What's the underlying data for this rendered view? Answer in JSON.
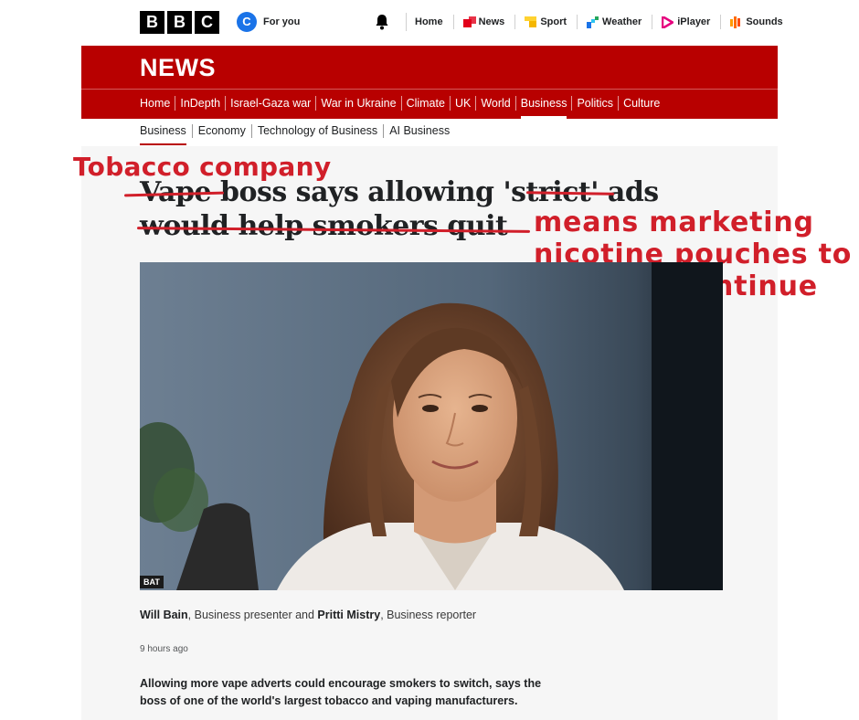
{
  "logo": {
    "letters": [
      "B",
      "B",
      "C"
    ]
  },
  "account": {
    "avatar_letter": "C",
    "label": "For you"
  },
  "topnav": [
    {
      "label": "Home",
      "icon": "none"
    },
    {
      "label": "News",
      "icon": "news-icon"
    },
    {
      "label": "Sport",
      "icon": "sport-icon"
    },
    {
      "label": "Weather",
      "icon": "weather-icon"
    },
    {
      "label": "iPlayer",
      "icon": "iplayer-icon"
    },
    {
      "label": "Sounds",
      "icon": "sounds-icon"
    }
  ],
  "news": {
    "title": "NEWS",
    "nav": [
      "Home",
      "InDepth",
      "Israel-Gaza war",
      "War in Ukraine",
      "Climate",
      "UK",
      "World",
      "Business",
      "Politics",
      "Culture"
    ],
    "active": "Business"
  },
  "subnav": [
    "Business",
    "Economy",
    "Technology of Business",
    "AI Business"
  ],
  "headline": {
    "w1": "Vape",
    "w2": " boss says allowing '",
    "w3": "strict",
    "w4": "' ads",
    "line2": "would help smokers quit"
  },
  "annotations": {
    "top": "Tobacco company",
    "side_line1": "means marketing",
    "side_line2": "nicotine pouches to",
    "side_line3": "kids can continue"
  },
  "photo": {
    "credit": "BAT"
  },
  "byline": {
    "author1": "Will Bain",
    "role1": ", Business presenter and ",
    "author2": "Pritti Mistry",
    "role2": ", Business reporter"
  },
  "timestamp": "9 hours ago",
  "summary": "Allowing more vape adverts could encourage smokers to switch, says the boss of one of the world's largest tobacco and vaping manufacturers.",
  "colors": {
    "bbc_red": "#b80000",
    "annotation_red": "#d11f2a"
  }
}
